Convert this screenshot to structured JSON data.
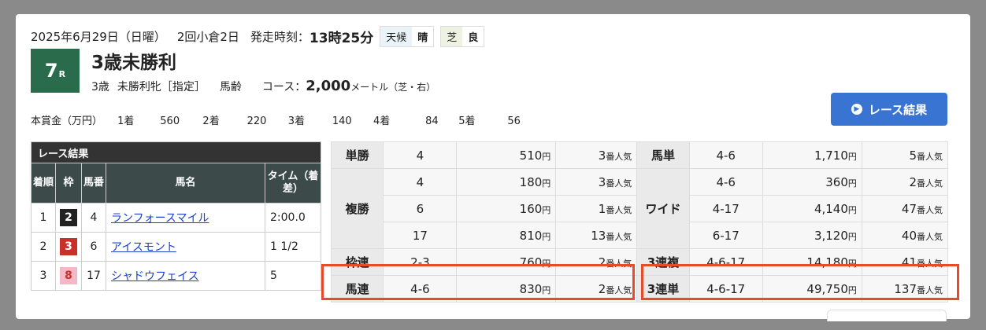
{
  "header": {
    "date": "2025年6月29日（日曜）",
    "meeting": "2回小倉2日",
    "start_label": "発走時刻：",
    "start_time": "13時25分",
    "weather_label": "天候",
    "weather_value": "晴",
    "track_label": "芝",
    "track_value": "良"
  },
  "race": {
    "number": "7",
    "suffix": "R",
    "name": "3歳未勝利",
    "age": "3歳",
    "class": "未勝利牝［指定］",
    "weight": "馬齢",
    "course_label": "コース：",
    "distance": "2,000",
    "unit": "メートル（芝・右）"
  },
  "prize": {
    "label": "本賞金（万円）",
    "items": [
      {
        "place": "1着",
        "amount": "560"
      },
      {
        "place": "2着",
        "amount": "220"
      },
      {
        "place": "3着",
        "amount": "140"
      },
      {
        "place": "4着",
        "amount": "84"
      },
      {
        "place": "5着",
        "amount": "56"
      }
    ]
  },
  "result_button": {
    "label": "レース結果"
  },
  "results": {
    "title": "レース結果",
    "headers": {
      "rank": "着順",
      "waku": "枠",
      "umaban": "馬番",
      "name": "馬名",
      "time": "タイム（着差）"
    },
    "rows": [
      {
        "rank": "1",
        "waku": "2",
        "umaban": "4",
        "name": "ランフォースマイル",
        "time": "2:00.0"
      },
      {
        "rank": "2",
        "waku": "3",
        "umaban": "6",
        "name": "アイスモント",
        "time": "1 1/2"
      },
      {
        "rank": "3",
        "waku": "8",
        "umaban": "17",
        "name": "シャドウフェイス",
        "time": "5"
      }
    ]
  },
  "payout": {
    "yen": "円",
    "ninki": "番人気",
    "tansho": {
      "label": "単勝",
      "combo": "4",
      "amount": "510",
      "pop": "3"
    },
    "fukusho": {
      "label": "複勝",
      "rows": [
        {
          "combo": "4",
          "amount": "180",
          "pop": "3"
        },
        {
          "combo": "6",
          "amount": "160",
          "pop": "1"
        },
        {
          "combo": "17",
          "amount": "810",
          "pop": "13"
        }
      ]
    },
    "wakuren": {
      "label": "枠連",
      "combo": "2-3",
      "amount": "760",
      "pop": "2"
    },
    "umaren": {
      "label": "馬連",
      "combo": "4-6",
      "amount": "830",
      "pop": "2"
    },
    "umatan": {
      "label": "馬単",
      "combo": "4-6",
      "amount": "1,710",
      "pop": "5"
    },
    "wide": {
      "label": "ワイド",
      "rows": [
        {
          "combo": "4-6",
          "amount": "360",
          "pop": "2"
        },
        {
          "combo": "4-17",
          "amount": "4,140",
          "pop": "47"
        },
        {
          "combo": "6-17",
          "amount": "3,120",
          "pop": "40"
        }
      ]
    },
    "sanrenpuku": {
      "label": "3連複",
      "combo": "4-6-17",
      "amount": "14,180",
      "pop": "41"
    },
    "sanrentan": {
      "label": "3連単",
      "combo": "4-6-17",
      "amount": "49,750",
      "pop": "137"
    }
  },
  "colors": {
    "race_badge": "#2a6b4c",
    "button": "#3a74d3",
    "highlight": "#e94b2a",
    "waku2": "#222222",
    "waku3": "#c8302c",
    "waku8": "#f2b8c6"
  }
}
